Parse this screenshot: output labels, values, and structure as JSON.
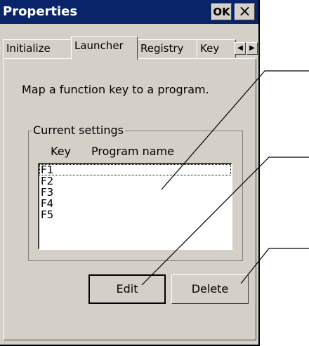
{
  "titlebar": {
    "title": "Properties",
    "ok_label": "OK",
    "close_label": "×"
  },
  "tabs": [
    {
      "label": "Initialize"
    },
    {
      "label": "Launcher"
    },
    {
      "label": "Registry"
    },
    {
      "label": "Key"
    }
  ],
  "tab_scroll": {
    "left": "◀",
    "right": "▶"
  },
  "description": "Map a function key to a program.",
  "group": {
    "legend": "Current settings",
    "columns": {
      "key": "Key",
      "program": "Program name"
    },
    "items": [
      "F1",
      "F2",
      "F3",
      "F4",
      "F5"
    ]
  },
  "buttons": {
    "edit": "Edit",
    "delete": "Delete"
  }
}
